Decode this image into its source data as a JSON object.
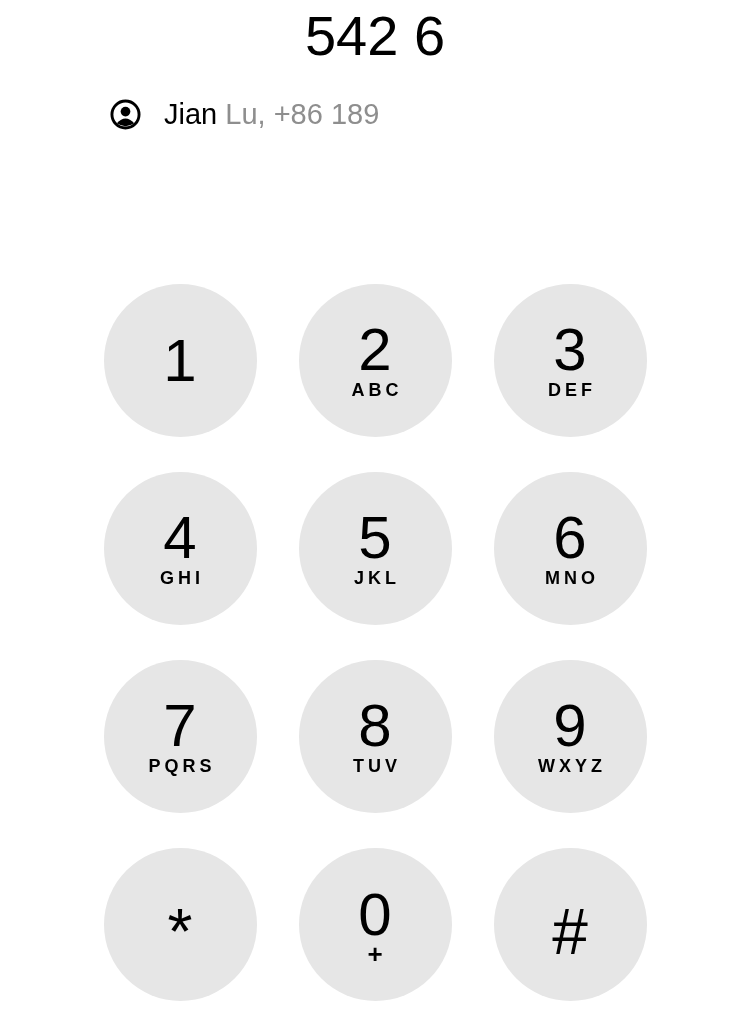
{
  "display": {
    "number": "542 6"
  },
  "suggestion": {
    "matched": "Jian",
    "rest": "Lu, +86 189"
  },
  "keys": [
    {
      "digit": "1"
    },
    {
      "digit": "2",
      "letters": "ABC"
    },
    {
      "digit": "3",
      "letters": "DEF"
    },
    {
      "digit": "4",
      "letters": "GHI"
    },
    {
      "digit": "5",
      "letters": "JKL"
    },
    {
      "digit": "6",
      "letters": "MNO"
    },
    {
      "digit": "7",
      "letters": "PQRS"
    },
    {
      "digit": "8",
      "letters": "TUV"
    },
    {
      "digit": "9",
      "letters": "WXYZ"
    },
    {
      "digit": "*"
    },
    {
      "digit": "0",
      "letters": "+"
    },
    {
      "digit": "#"
    }
  ]
}
